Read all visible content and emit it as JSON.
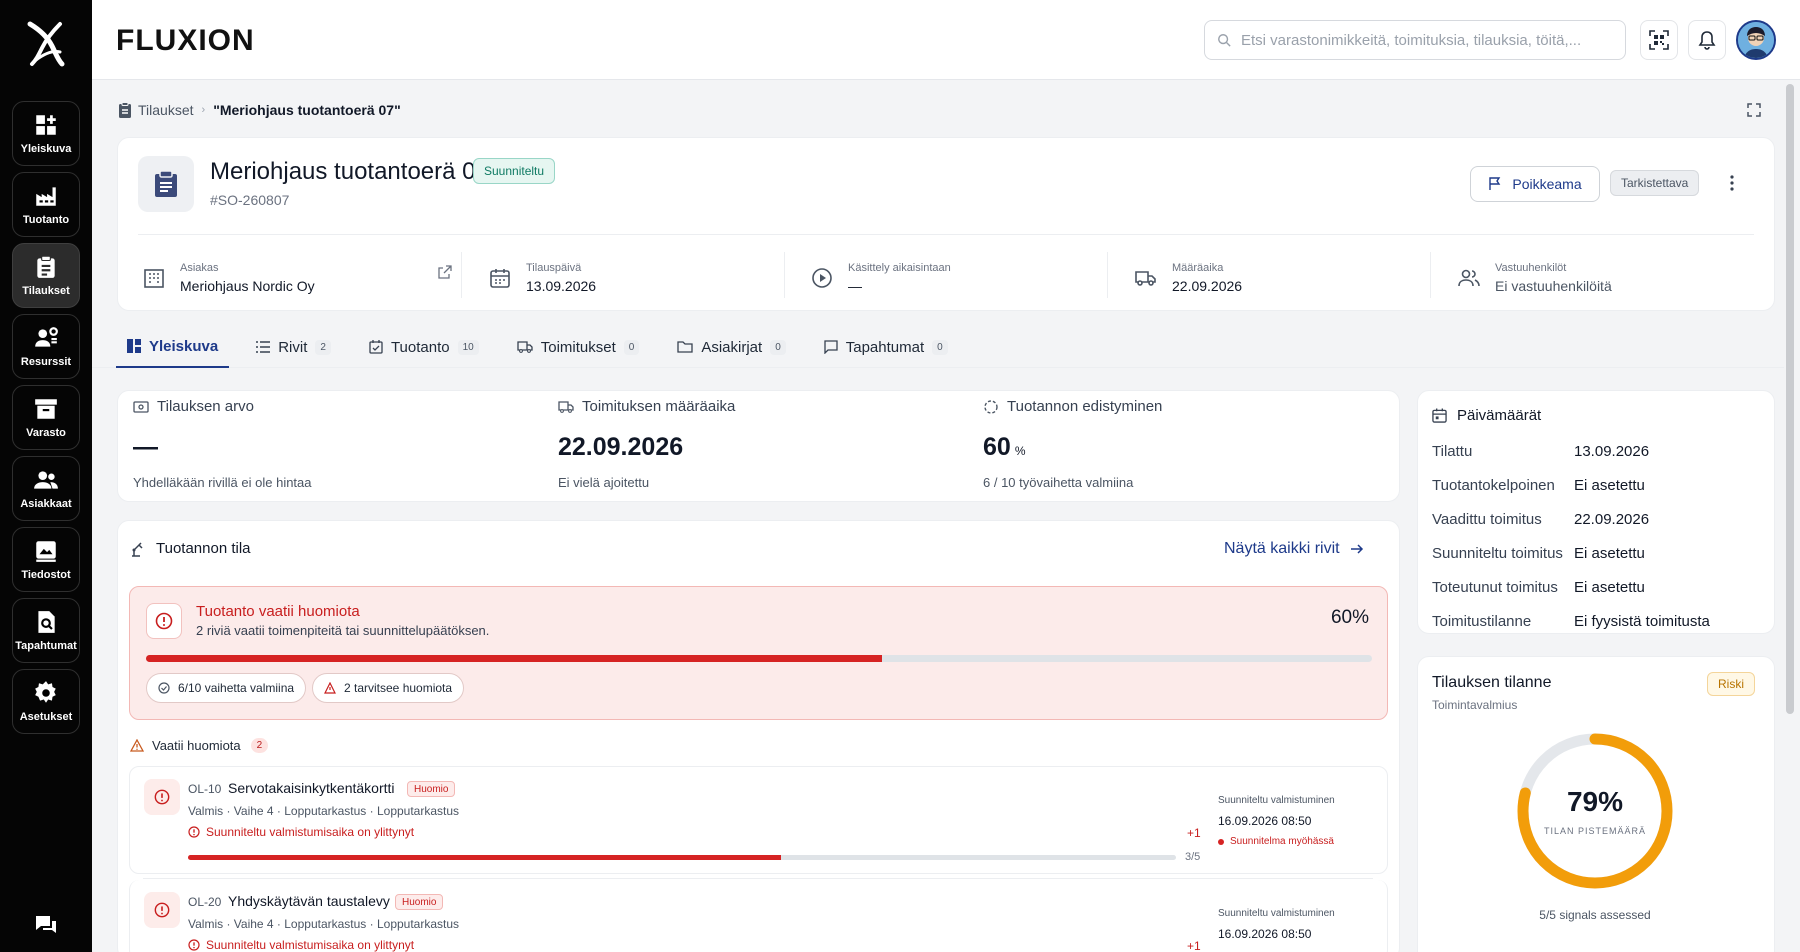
{
  "app": {
    "brand": "FLUXION"
  },
  "search": {
    "placeholder": "Etsi varastonimikkeitä, toimituksia, tilauksia, töitä,..."
  },
  "sidebar": {
    "items": [
      {
        "label": "Yleiskuva",
        "icon": "dashboard-icon"
      },
      {
        "label": "Tuotanto",
        "icon": "factory-icon"
      },
      {
        "label": "Tilaukset",
        "icon": "clipboard-icon"
      },
      {
        "label": "Resurssit",
        "icon": "resources-icon"
      },
      {
        "label": "Varasto",
        "icon": "archive-icon"
      },
      {
        "label": "Asiakkaat",
        "icon": "people-icon"
      },
      {
        "label": "Tiedostot",
        "icon": "files-icon"
      },
      {
        "label": "Tapahtumat",
        "icon": "event-search-icon"
      },
      {
        "label": "Asetukset",
        "icon": "gear-icon"
      }
    ]
  },
  "breadcrumb": {
    "parent": "Tilaukset",
    "current": "\"Meriohjaus tuotantoerä 07\""
  },
  "order": {
    "title": "Meriohjaus tuotantoerä 07",
    "status": "Suunniteltu",
    "code": "#SO-260807",
    "deviation_button": "Poikkeama",
    "review_chip": "Tarkistettava"
  },
  "meta": [
    {
      "label": "Asiakas",
      "value": "Meriohjaus Nordic Oy"
    },
    {
      "label": "Tilauspäivä",
      "value": "13.09.2026"
    },
    {
      "label": "Käsittely aikaisintaan",
      "value": "—"
    },
    {
      "label": "Määräaika",
      "value": "22.09.2026"
    },
    {
      "label": "Vastuuhenkilöt",
      "value": "Ei vastuuhenkilöitä"
    }
  ],
  "tabs": [
    {
      "label": "Yleiskuva",
      "count": ""
    },
    {
      "label": "Rivit",
      "count": "2"
    },
    {
      "label": "Tuotanto",
      "count": "10"
    },
    {
      "label": "Toimitukset",
      "count": "0"
    },
    {
      "label": "Asiakirjat",
      "count": "0"
    },
    {
      "label": "Tapahtumat",
      "count": "0"
    }
  ],
  "kpis": [
    {
      "title": "Tilauksen arvo",
      "value": "—",
      "unit": "",
      "sub": "Yhdelläkään rivillä ei ole hintaa"
    },
    {
      "title": "Toimituksen määräaika",
      "value": "22.09.2026",
      "unit": "",
      "sub": "Ei vielä ajoitettu"
    },
    {
      "title": "Tuotannon edistyminen",
      "value": "60",
      "unit": "%",
      "sub": "6 / 10 työvaihetta valmiina"
    }
  ],
  "production": {
    "title": "Tuotannon tila",
    "link": "Näytä kaikki rivit",
    "alert_title": "Tuotanto vaatii huomiota",
    "alert_sub": "2 riviä vaatii toimenpiteitä tai suunnittelupäätöksen.",
    "alert_percent": "60%",
    "progress": 0.6,
    "pill_done": "6/10 vaihetta valmiina",
    "pill_attention": "2 tarvitsee huomiota",
    "needs_label": "Vaatii huomiota",
    "needs_count": "2"
  },
  "rows": [
    {
      "code": "OL-10",
      "name": "Servotakaisinkytkentäkortti",
      "badge": "Huomio",
      "path": "Valmis · Vaihe 4 · Lopputarkastus · Lopputarkastus",
      "warning": "Suunniteltu valmistumisaika on ylittynyt",
      "plus": "+1",
      "progress": 0.6,
      "fraction": "3/5",
      "planned_label": "Suunniteltu valmistuminen",
      "planned_date": "16.09.2026 08:50",
      "late": "Suunnitelma myöhässä"
    },
    {
      "code": "OL-20",
      "name": "Yhdyskäytävän taustalevy",
      "badge": "Huomio",
      "path": "Valmis · Vaihe 4 · Lopputarkastus · Lopputarkastus",
      "warning": "Suunniteltu valmistumisaika on ylittynyt",
      "plus": "+1",
      "planned_label": "Suunniteltu valmistuminen",
      "planned_date": "16.09.2026 08:50"
    }
  ],
  "dates": {
    "title": "Päivämäärät",
    "items": [
      {
        "label": "Tilattu",
        "value": "13.09.2026"
      },
      {
        "label": "Tuotantokelpoinen",
        "value": "Ei asetettu"
      },
      {
        "label": "Vaadittu toimitus",
        "value": "22.09.2026"
      },
      {
        "label": "Suunniteltu toimitus",
        "value": "Ei asetettu"
      },
      {
        "label": "Toteutunut toimitus",
        "value": "Ei asetettu"
      },
      {
        "label": "Toimitustilanne",
        "value": "Ei fyysistä toimitusta"
      }
    ]
  },
  "status_card": {
    "title": "Tilauksen tilanne",
    "subtitle": "Toimintavalmius",
    "badge": "Riski",
    "score": 0.79,
    "score_text": "79%",
    "score_label": "TILAN PISTEMÄÄRÄ",
    "footer": "5/5 signals assessed"
  },
  "colors": {
    "accent": "#1e3a8a",
    "danger": "#d62323",
    "warning": "#f29d0a",
    "success": "#0f7a63"
  }
}
